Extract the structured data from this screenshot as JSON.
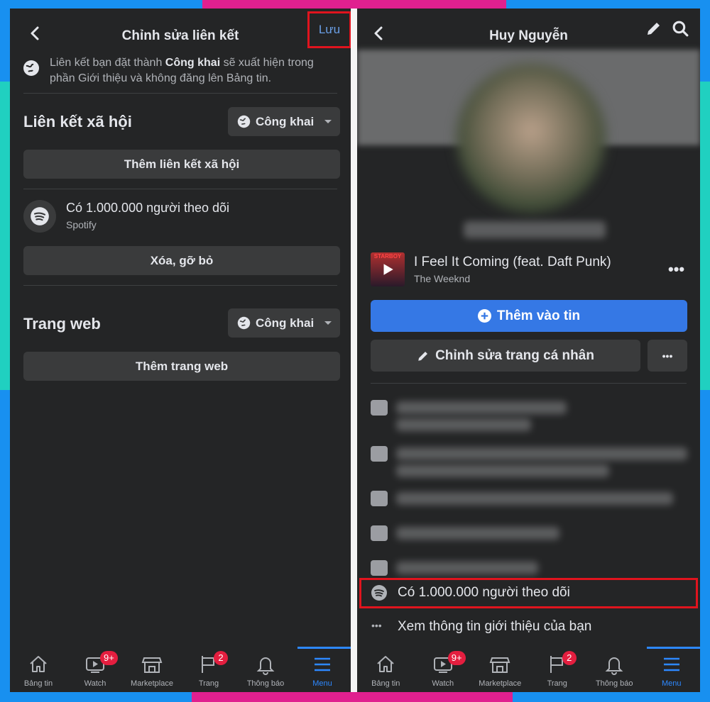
{
  "colors": {
    "frame_blue": "#1890f0",
    "frame_pink": "#e0208f",
    "frame_teal": "#20d0c0",
    "bg": "#242526",
    "button": "#3a3b3c",
    "accent": "#2d88ff",
    "primary_button": "#3578e5",
    "highlight_box": "#e0141e",
    "badge": "#e41e3f"
  },
  "left": {
    "header": {
      "title": "Chỉnh sửa liên kết",
      "save": "Lưu"
    },
    "notice": {
      "before": "Liên kết bạn đặt thành ",
      "bold": "Công khai",
      "after": " sẽ xuất hiện trong phần Giới thiệu và không đăng lên Bảng tin."
    },
    "social": {
      "title": "Liên kết xã hội",
      "privacy": "Công khai",
      "add": "Thêm liên kết xã hội"
    },
    "spotify": {
      "title": "Có 1.000.000 người theo dõi",
      "source": "Spotify",
      "remove": "Xóa, gỡ bỏ"
    },
    "web": {
      "title": "Trang web",
      "privacy": "Công khai",
      "add": "Thêm trang web"
    }
  },
  "right": {
    "header": {
      "title": "Huy Nguyễn"
    },
    "music": {
      "song": "I Feel It Coming (feat. Daft Punk)",
      "artist": "The Weeknd",
      "album_art_text": "STARBOY"
    },
    "add_story": "Thêm vào tin",
    "edit_profile": "Chỉnh sửa trang cá nhân",
    "spotify_row": "Có 1.000.000 người theo dõi",
    "see_about": "Xem thông tin giới thiệu của bạn"
  },
  "tabbar": {
    "items": [
      {
        "label": "Bảng tin",
        "icon": "home-icon"
      },
      {
        "label": "Watch",
        "icon": "watch-icon",
        "badge": "9+"
      },
      {
        "label": "Marketplace",
        "icon": "marketplace-icon"
      },
      {
        "label": "Trang",
        "icon": "flag-icon",
        "badge": "2"
      },
      {
        "label": "Thông báo",
        "icon": "bell-icon"
      },
      {
        "label": "Menu",
        "icon": "menu-icon",
        "active": true
      }
    ]
  }
}
